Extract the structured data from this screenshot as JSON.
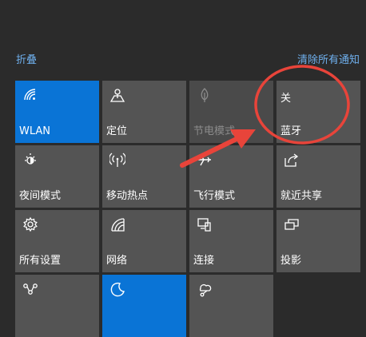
{
  "header": {
    "collapse_label": "折叠",
    "clear_label": "清除所有通知"
  },
  "tiles": [
    {
      "label": "WLAN",
      "icon": "wifi-icon",
      "state": "active"
    },
    {
      "label": "定位",
      "icon": "location-icon",
      "state": "normal"
    },
    {
      "label": "节电模式",
      "icon": "battery-saver-icon",
      "state": "disabled"
    },
    {
      "label": "蓝牙",
      "sub": "关",
      "icon": "bluetooth-icon",
      "state": "normal"
    },
    {
      "label": "夜间模式",
      "icon": "night-light-icon",
      "state": "normal"
    },
    {
      "label": "移动热点",
      "icon": "mobile-hotspot-icon",
      "state": "normal"
    },
    {
      "label": "飞行模式",
      "icon": "airplane-icon",
      "state": "normal"
    },
    {
      "label": "就近共享",
      "icon": "share-icon",
      "state": "normal"
    },
    {
      "label": "所有设置",
      "icon": "settings-gear-icon",
      "state": "normal"
    },
    {
      "label": "网络",
      "icon": "network-icon",
      "state": "normal"
    },
    {
      "label": "连接",
      "icon": "connect-icon",
      "state": "normal"
    },
    {
      "label": "投影",
      "icon": "project-icon",
      "state": "normal"
    },
    {
      "label": "",
      "icon": "vpn-icon",
      "state": "normal"
    },
    {
      "label": "",
      "icon": "focus-assist-moon-icon",
      "state": "active"
    },
    {
      "label": "",
      "icon": "screen-snip-icon",
      "state": "normal"
    }
  ],
  "colors": {
    "background": "#2b2b2b",
    "tile": "#545454",
    "tile_active": "#0a74d6",
    "link": "#6fb0ee",
    "annotation": "#e8443a"
  }
}
